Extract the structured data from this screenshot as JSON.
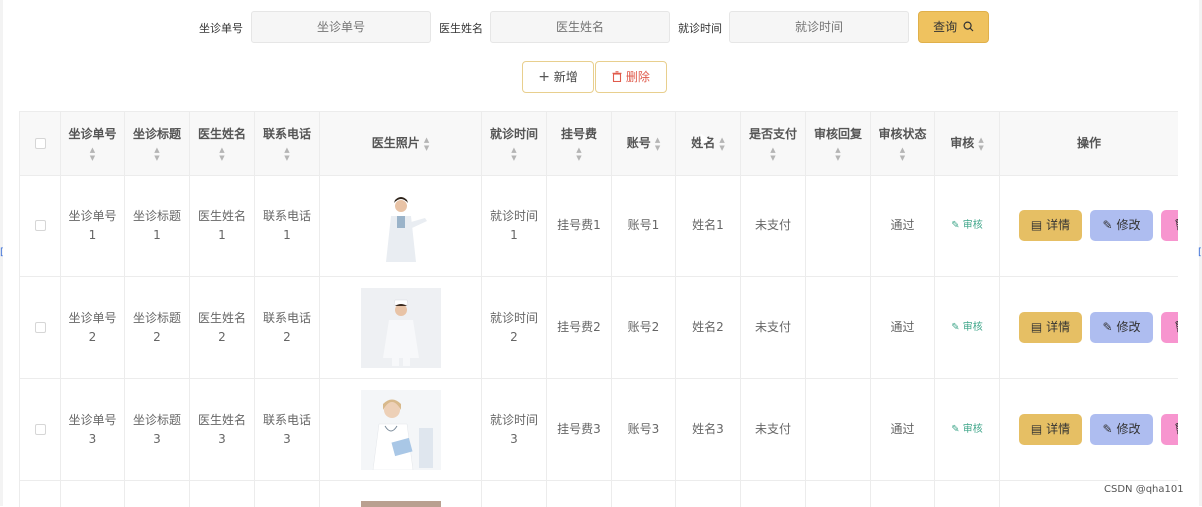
{
  "search": {
    "fields": [
      {
        "label": "坐诊单号",
        "placeholder": "坐诊单号"
      },
      {
        "label": "医生姓名",
        "placeholder": "医生姓名"
      },
      {
        "label": "就诊时间",
        "placeholder": "就诊时间"
      }
    ],
    "query_label": "查询"
  },
  "actions": {
    "add_label": "新增",
    "delete_label": "删除"
  },
  "table": {
    "headers": {
      "no": "坐诊单号",
      "title": "坐诊标题",
      "doctor": "医生姓名",
      "phone": "联系电话",
      "photo": "医生照片",
      "time": "就诊时间",
      "fee": "挂号费",
      "account": "账号",
      "name": "姓名",
      "paid": "是否支付",
      "reply": "审核回复",
      "status": "审核状态",
      "audit": "审核",
      "ops": "操作"
    },
    "rows": [
      {
        "no": "坐诊单号1",
        "title": "坐诊标题1",
        "doctor": "医生姓名1",
        "phone": "联系电话1",
        "time": "就诊时间1",
        "fee": "挂号费1",
        "account": "账号1",
        "name": "姓名1",
        "paid": "未支付",
        "reply": "",
        "status": "通过",
        "audit": "审核",
        "photo_desc": "doctor-male-white-coat"
      },
      {
        "no": "坐诊单号2",
        "title": "坐诊标题2",
        "doctor": "医生姓名2",
        "phone": "联系电话2",
        "time": "就诊时间2",
        "fee": "挂号费2",
        "account": "账号2",
        "name": "姓名2",
        "paid": "未支付",
        "reply": "",
        "status": "通过",
        "audit": "审核",
        "photo_desc": "nurse-white-uniform"
      },
      {
        "no": "坐诊单号3",
        "title": "坐诊标题3",
        "doctor": "医生姓名3",
        "phone": "联系电话3",
        "time": "就诊时间3",
        "fee": "挂号费3",
        "account": "账号3",
        "name": "姓名3",
        "paid": "未支付",
        "reply": "",
        "status": "通过",
        "audit": "审核",
        "photo_desc": "doctor-female-clipboard"
      }
    ],
    "op_labels": {
      "detail": "详情",
      "edit": "修改"
    }
  },
  "watermark": "CSDN @qha101",
  "colors": {
    "primary": "#efc25f",
    "detail": "#e6bf64",
    "edit": "#aebdf0",
    "delete": "#f795cf",
    "danger_text": "#e05a4b",
    "audit_link": "#3fa68a"
  },
  "icons": {
    "query": "search-icon",
    "add": "plus-icon",
    "delete": "trash-icon",
    "detail": "document-icon",
    "edit": "pencil-icon",
    "audit": "pencil-icon"
  }
}
